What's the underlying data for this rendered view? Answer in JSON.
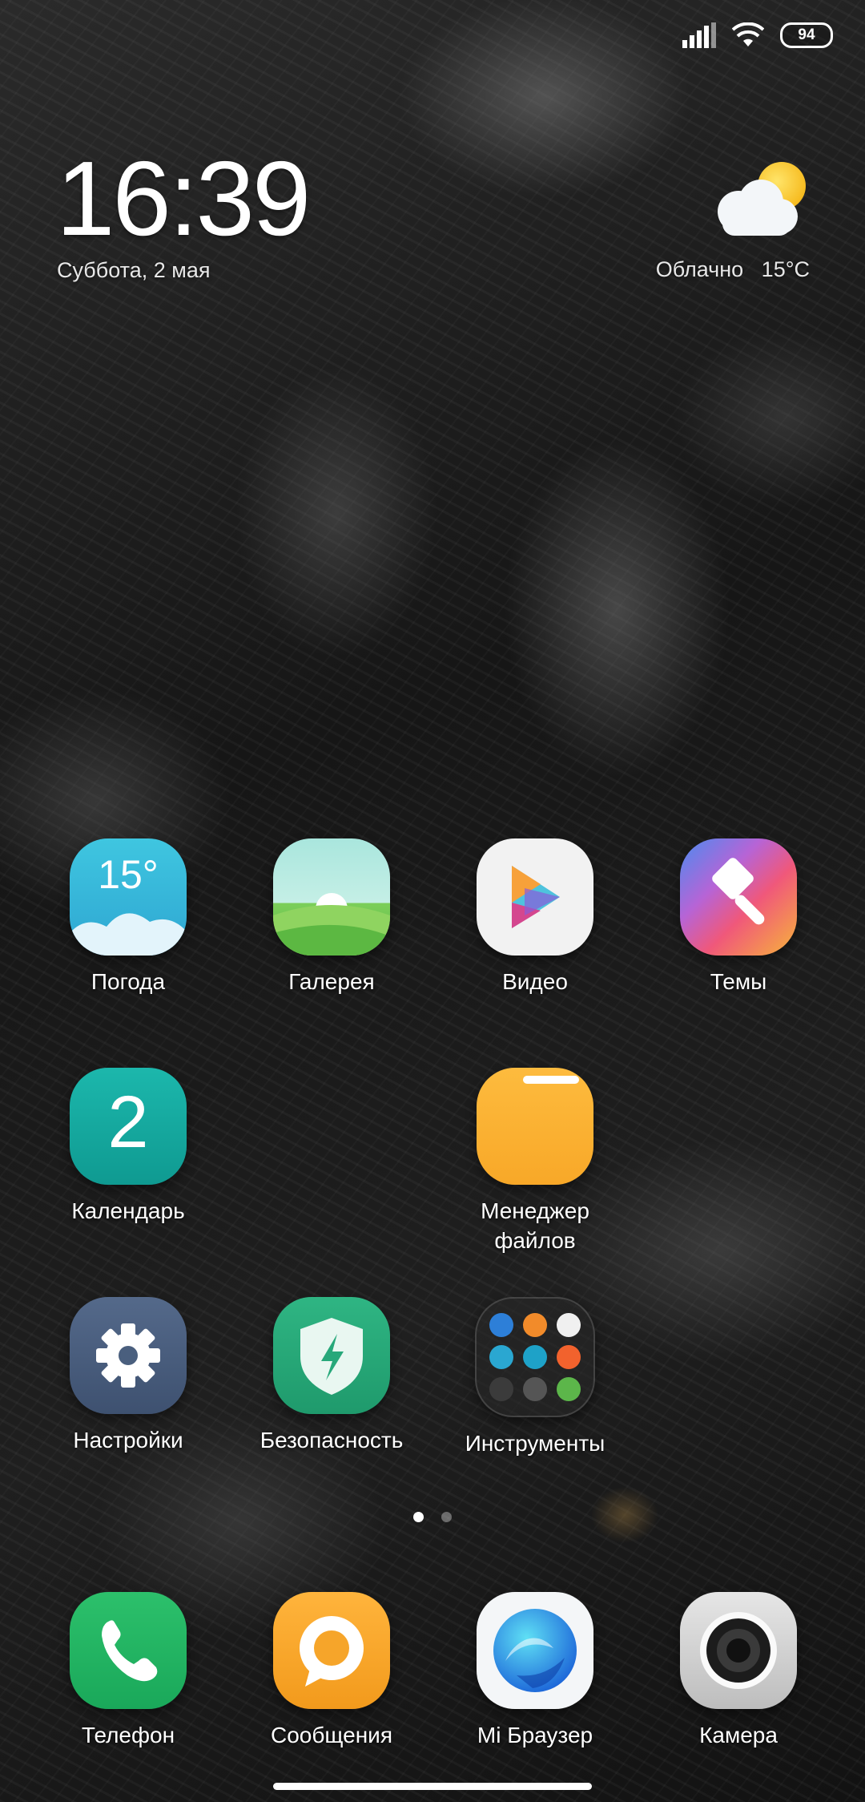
{
  "status_bar": {
    "battery": "94",
    "icons": [
      "signal-icon",
      "wifi-icon",
      "battery-icon"
    ]
  },
  "clock_widget": {
    "time": "16:39",
    "date": "Суббота, 2 мая"
  },
  "weather_widget": {
    "condition": "Облачно",
    "temperature": "15°C",
    "icon": "partly-cloudy-icon"
  },
  "apps": {
    "weather": {
      "label": "Погода",
      "icon_text": "15°"
    },
    "gallery": {
      "label": "Галерея"
    },
    "video": {
      "label": "Видео"
    },
    "themes": {
      "label": "Темы"
    },
    "calendar": {
      "label": "Календарь",
      "icon_text": "2"
    },
    "files": {
      "label": "Менеджер\nфайлов"
    },
    "settings": {
      "label": "Настройки"
    },
    "security": {
      "label": "Безопасность"
    },
    "tools": {
      "label": "Инструменты"
    }
  },
  "page_indicator": {
    "pages": 2,
    "current": 1
  },
  "dock": {
    "phone": {
      "label": "Телефон"
    },
    "messages": {
      "label": "Сообщения"
    },
    "browser": {
      "label": "Mi Браузер"
    },
    "camera": {
      "label": "Камера"
    }
  },
  "colors": {
    "weather_icon": "#3fb8d6",
    "gallery_icon": "#7ccf5a",
    "calendar_icon": "#17a99f",
    "files_icon": "#fbb034",
    "settings_icon": "#4a5f78",
    "security_icon": "#27a87a",
    "phone_icon": "#22b463",
    "messages_icon": "#f6a52a",
    "browser_icon": "#1d86e8"
  }
}
